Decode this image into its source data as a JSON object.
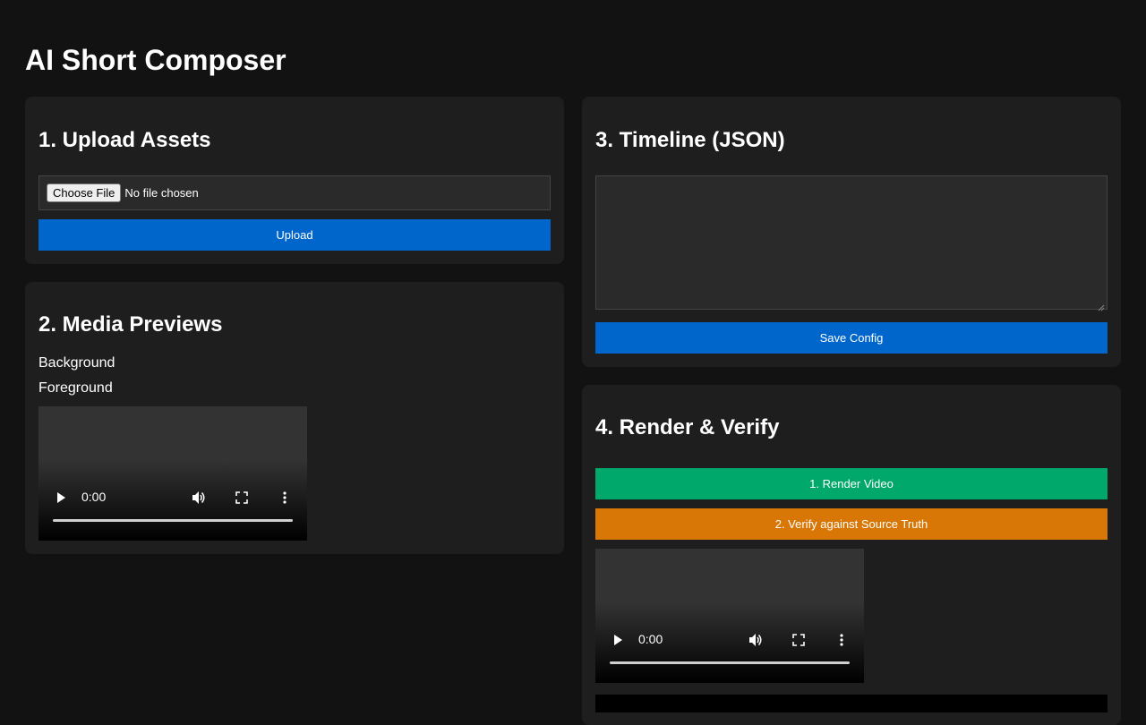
{
  "app": {
    "title": "AI Short Composer"
  },
  "upload": {
    "heading": "1. Upload Assets",
    "choose_label": "Choose File",
    "file_status": "No file chosen",
    "upload_label": "Upload"
  },
  "previews": {
    "heading": "2. Media Previews",
    "background_label": "Background",
    "foreground_label": "Foreground",
    "video_time": "0:00"
  },
  "timeline": {
    "heading": "3. Timeline (JSON)",
    "json_value": "",
    "save_label": "Save Config"
  },
  "render": {
    "heading": "4. Render & Verify",
    "render_label": "1. Render Video",
    "verify_label": "2. Verify against Source Truth",
    "video_time": "0:00"
  },
  "colors": {
    "blue": "#0066cc",
    "green": "#00a86b",
    "orange": "#d97706",
    "card": "#1e1e1e",
    "page": "#121212"
  },
  "icons": [
    "play-icon",
    "volume-icon",
    "fullscreen-icon",
    "more-vert-icon",
    "resize-grip-icon"
  ]
}
